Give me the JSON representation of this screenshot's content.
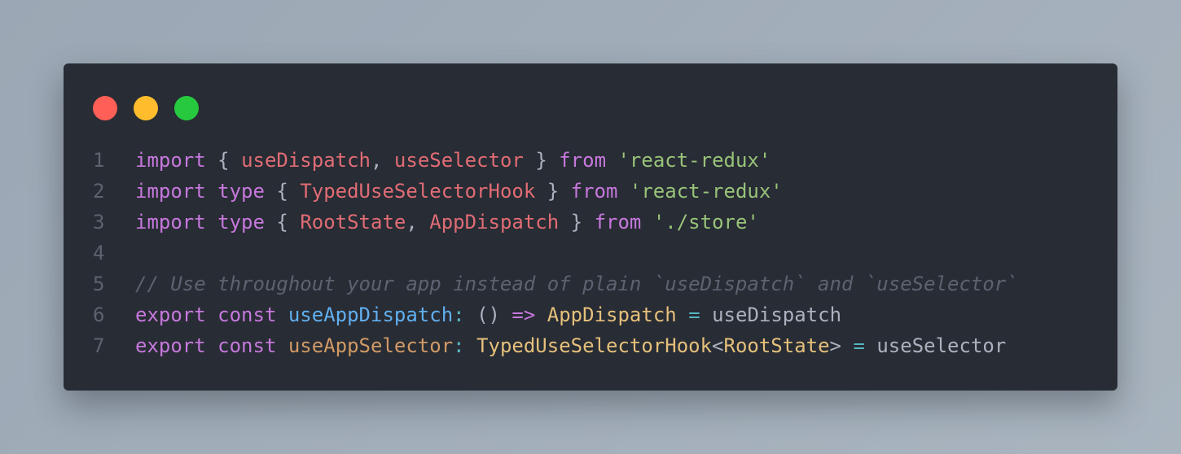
{
  "window": {
    "dots": [
      {
        "name": "close-dot",
        "color": "#ff5f56"
      },
      {
        "name": "minimize-dot",
        "color": "#ffbd2e"
      },
      {
        "name": "maximize-dot",
        "color": "#27c93f"
      }
    ]
  },
  "code": {
    "lines": [
      {
        "number": "1",
        "tokens": [
          {
            "t": "import",
            "c": "kw"
          },
          {
            "t": " { ",
            "c": "plain"
          },
          {
            "t": "useDispatch",
            "c": "name"
          },
          {
            "t": ", ",
            "c": "plain"
          },
          {
            "t": "useSelector",
            "c": "name"
          },
          {
            "t": " } ",
            "c": "plain"
          },
          {
            "t": "from",
            "c": "kw"
          },
          {
            "t": " ",
            "c": "plain"
          },
          {
            "t": "'react-redux'",
            "c": "str"
          }
        ]
      },
      {
        "number": "2",
        "tokens": [
          {
            "t": "import",
            "c": "kw"
          },
          {
            "t": " ",
            "c": "plain"
          },
          {
            "t": "type",
            "c": "kw"
          },
          {
            "t": " { ",
            "c": "plain"
          },
          {
            "t": "TypedUseSelectorHook",
            "c": "name"
          },
          {
            "t": " } ",
            "c": "plain"
          },
          {
            "t": "from",
            "c": "kw"
          },
          {
            "t": " ",
            "c": "plain"
          },
          {
            "t": "'react-redux'",
            "c": "str"
          }
        ]
      },
      {
        "number": "3",
        "tokens": [
          {
            "t": "import",
            "c": "kw"
          },
          {
            "t": " ",
            "c": "plain"
          },
          {
            "t": "type",
            "c": "kw"
          },
          {
            "t": " { ",
            "c": "plain"
          },
          {
            "t": "RootState",
            "c": "name"
          },
          {
            "t": ", ",
            "c": "plain"
          },
          {
            "t": "AppDispatch",
            "c": "name"
          },
          {
            "t": " } ",
            "c": "plain"
          },
          {
            "t": "from",
            "c": "kw"
          },
          {
            "t": " ",
            "c": "plain"
          },
          {
            "t": "'./store'",
            "c": "str"
          }
        ]
      },
      {
        "number": "4",
        "tokens": []
      },
      {
        "number": "5",
        "tokens": [
          {
            "t": "// Use throughout your app instead of plain `useDispatch` and `useSelector`",
            "c": "comment"
          }
        ]
      },
      {
        "number": "6",
        "tokens": [
          {
            "t": "export",
            "c": "kw"
          },
          {
            "t": " ",
            "c": "plain"
          },
          {
            "t": "const",
            "c": "kw"
          },
          {
            "t": " ",
            "c": "plain"
          },
          {
            "t": "useAppDispatch",
            "c": "fn"
          },
          {
            "t": ": ",
            "c": "op"
          },
          {
            "t": "() ",
            "c": "plain"
          },
          {
            "t": "=>",
            "c": "kw"
          },
          {
            "t": " ",
            "c": "plain"
          },
          {
            "t": "AppDispatch",
            "c": "type"
          },
          {
            "t": " ",
            "c": "plain"
          },
          {
            "t": "=",
            "c": "op"
          },
          {
            "t": " useDispatch",
            "c": "plain"
          }
        ]
      },
      {
        "number": "7",
        "tokens": [
          {
            "t": "export",
            "c": "kw"
          },
          {
            "t": " ",
            "c": "plain"
          },
          {
            "t": "const",
            "c": "kw"
          },
          {
            "t": " ",
            "c": "plain"
          },
          {
            "t": "useAppSelector",
            "c": "prop"
          },
          {
            "t": ": ",
            "c": "op"
          },
          {
            "t": "TypedUseSelectorHook",
            "c": "type"
          },
          {
            "t": "<",
            "c": "plain"
          },
          {
            "t": "RootState",
            "c": "type"
          },
          {
            "t": "> ",
            "c": "plain"
          },
          {
            "t": "=",
            "c": "op"
          },
          {
            "t": " useSelector",
            "c": "plain"
          }
        ]
      }
    ]
  }
}
